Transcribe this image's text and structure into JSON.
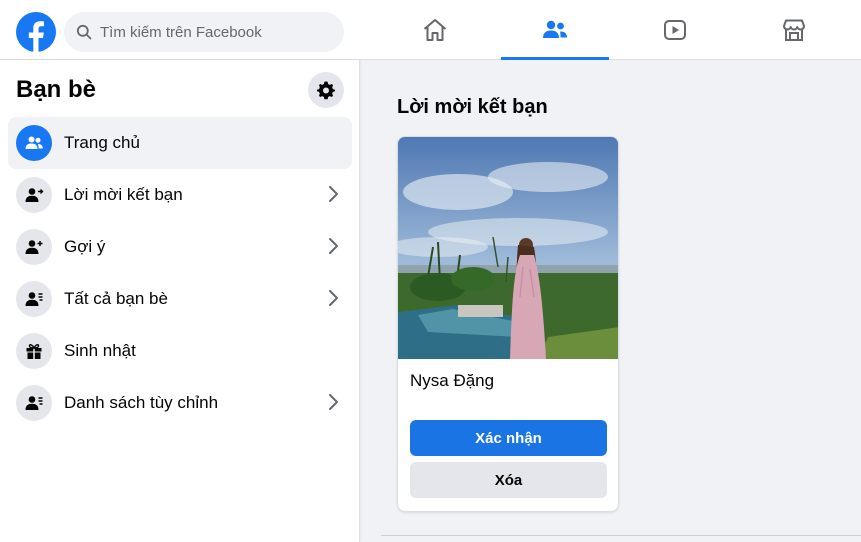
{
  "header": {
    "search_placeholder": "Tìm kiếm trên Facebook",
    "nav_tabs": [
      "home",
      "friends",
      "watch",
      "marketplace"
    ],
    "active_tab": "friends"
  },
  "sidebar": {
    "title": "Bạn bè",
    "items": [
      {
        "label": "Trang chủ",
        "icon": "friends-icon",
        "active": true
      },
      {
        "label": "Lời mời kết bạn",
        "icon": "friend-request-icon",
        "chevron": true
      },
      {
        "label": "Gợi ý",
        "icon": "add-friend-icon",
        "chevron": true
      },
      {
        "label": "Tất cả bạn bè",
        "icon": "friend-list-icon",
        "chevron": true
      },
      {
        "label": "Sinh nhật",
        "icon": "gift-icon"
      },
      {
        "label": "Danh sách tùy chỉnh",
        "icon": "custom-list-icon",
        "chevron": true
      }
    ]
  },
  "main": {
    "section_title": "Lời mời kết bạn",
    "requests": [
      {
        "name": "Nysa Đặng",
        "confirm_label": "Xác nhận",
        "delete_label": "Xóa"
      }
    ]
  },
  "colors": {
    "accent": "#1877f2",
    "button_primary": "#1b74e4",
    "background": "#f0f2f5"
  }
}
